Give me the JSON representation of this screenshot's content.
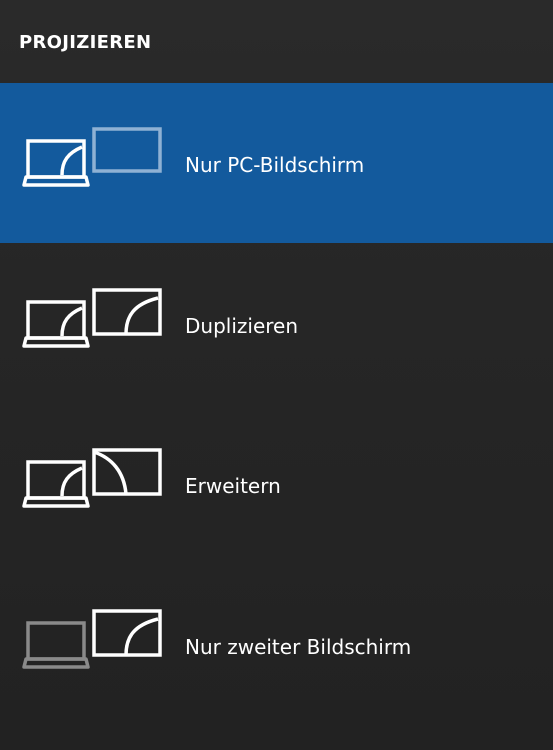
{
  "header": {
    "title": "PROJIZIEREN"
  },
  "options": [
    {
      "label": "Nur PC-Bildschirm",
      "icon": "pc-screen-only-icon",
      "selected": true
    },
    {
      "label": "Duplizieren",
      "icon": "duplicate-icon",
      "selected": false
    },
    {
      "label": "Erweitern",
      "icon": "extend-icon",
      "selected": false
    },
    {
      "label": "Nur zweiter Bildschirm",
      "icon": "second-screen-only-icon",
      "selected": false
    }
  ],
  "colors": {
    "background": "#242424",
    "selected_background": "#135a9d",
    "text": "#ffffff",
    "dimmed_icon": "#8a8a8a",
    "dimmed_monitor": "#8fb1d4"
  }
}
